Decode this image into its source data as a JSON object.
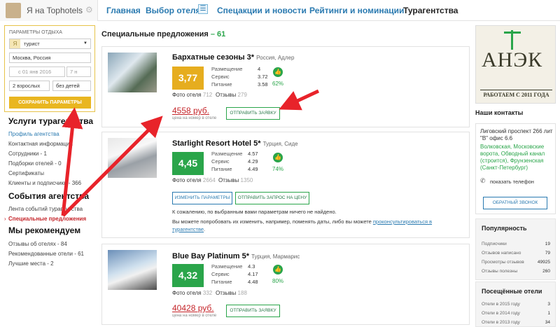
{
  "header": {
    "brand": "Я на Tophotels",
    "nav": [
      "Главная",
      "Выбор отеля",
      "Спецакции и новости",
      "Рейтинги и номинации",
      "Турагентства"
    ]
  },
  "params": {
    "title": "ПАРАМЕТРЫ ОТДЫХА",
    "user_type": "турист",
    "ya": "Я",
    "city": "Москва, Россия",
    "date": "с 01 янв 2016",
    "nights": "7 н",
    "adults": "2 взрослых",
    "kids": "без детей",
    "save": "СОХРАНИТЬ ПАРАМЕТРЫ"
  },
  "left": {
    "s1_title": "Услуги турагентства",
    "s1_items": [
      "Профиль агентства",
      "Контактная информация",
      "Сотрудники - 1",
      "Подборки отелей - 0",
      "Сертификаты",
      "Клиенты и подписчики - 366"
    ],
    "s2_title": "События агентства",
    "s2_items": [
      "Лента событий турагентства",
      "Специальные предложения"
    ],
    "s3_title": "Мы рекомендуем",
    "s3_items": [
      "Отзывы об отелях - 84",
      "Рекомендованные отели - 61",
      "Лучшие места - 2"
    ]
  },
  "main": {
    "title": "Специальные предложения",
    "count": "– 61",
    "labels": {
      "placement": "Размещение",
      "service": "Сервис",
      "food": "Питание",
      "photos": "Фото отеля",
      "reviews": "Отзывы",
      "price_sub": "цена на номер в отеле"
    },
    "hotels": [
      {
        "name": "Бархатные сезоны 3*",
        "location": "Россия, Адлер",
        "score": "3,77",
        "color": "#e6ad1f",
        "placement": "4",
        "service": "3.72",
        "food": "3.58",
        "pct": "62%",
        "photos": "712",
        "reviews": "279",
        "price": "4558 руб.",
        "btn": "ОТПРАВИТЬ ЗАЯВКУ"
      },
      {
        "name": "Starlight Resort Hotel 5*",
        "location": "Турция, Сиде",
        "score": "4,45",
        "color": "#2aa54a",
        "placement": "4.57",
        "service": "4.29",
        "food": "4.49",
        "pct": "74%",
        "photos": "2664",
        "reviews": "1350",
        "btn1": "ИЗМЕНИТЬ ПАРАМЕТРЫ",
        "btn2": "ОТПРАВИТЬ ЗАПРОС НА ЦЕНУ",
        "notice1": "К сожалению, по выбранным вами параметрам ничего не найдено.",
        "notice2": "Вы можете попробовать их изменить, например, поменять даты, либо вы можете",
        "notice_link": "проконсультироваться в турагентстве",
        "notice_end": "."
      },
      {
        "name": "Blue Bay Platinum 5*",
        "location": "Турция, Мармарис",
        "score": "4,32",
        "color": "#2aa54a",
        "placement": "4.3",
        "service": "4.17",
        "food": "4.48",
        "pct": "80%",
        "photos": "332",
        "reviews": "188",
        "price": "40428 руб.",
        "btn": "ОТПРАВИТЬ ЗАЯВКУ"
      }
    ]
  },
  "right": {
    "ad_line1": "АНЭК",
    "ad_line2": "РАБОТАЕМ С 2011 ГОДА",
    "contacts_title": "Наши контакты",
    "address": "Лиговский проспект 266 лит \"В\" офис 6.6",
    "metro": "Волковская, Московские ворота, Обводный канал (строится), Фрунзенская (Санкт-Петербург)",
    "phone": "показать телефон",
    "callback": "ОБРАТНЫЙ ЗВОНОК",
    "pop_title": "Популярность",
    "pop_rows": [
      {
        "label": "Подписчики",
        "value": "19"
      },
      {
        "label": "Отзывов написано",
        "value": "79"
      },
      {
        "label": "Просмотры отзывов",
        "value": "49925"
      },
      {
        "label": "Отзывы полезны",
        "value": "260"
      }
    ],
    "visited_title": "Посещённые отели",
    "visited_rows": [
      {
        "label": "Отели в 2015 году",
        "value": "3"
      },
      {
        "label": "Отели в 2014 году",
        "value": "1"
      },
      {
        "label": "Отели в 2013 году",
        "value": "34"
      }
    ]
  }
}
